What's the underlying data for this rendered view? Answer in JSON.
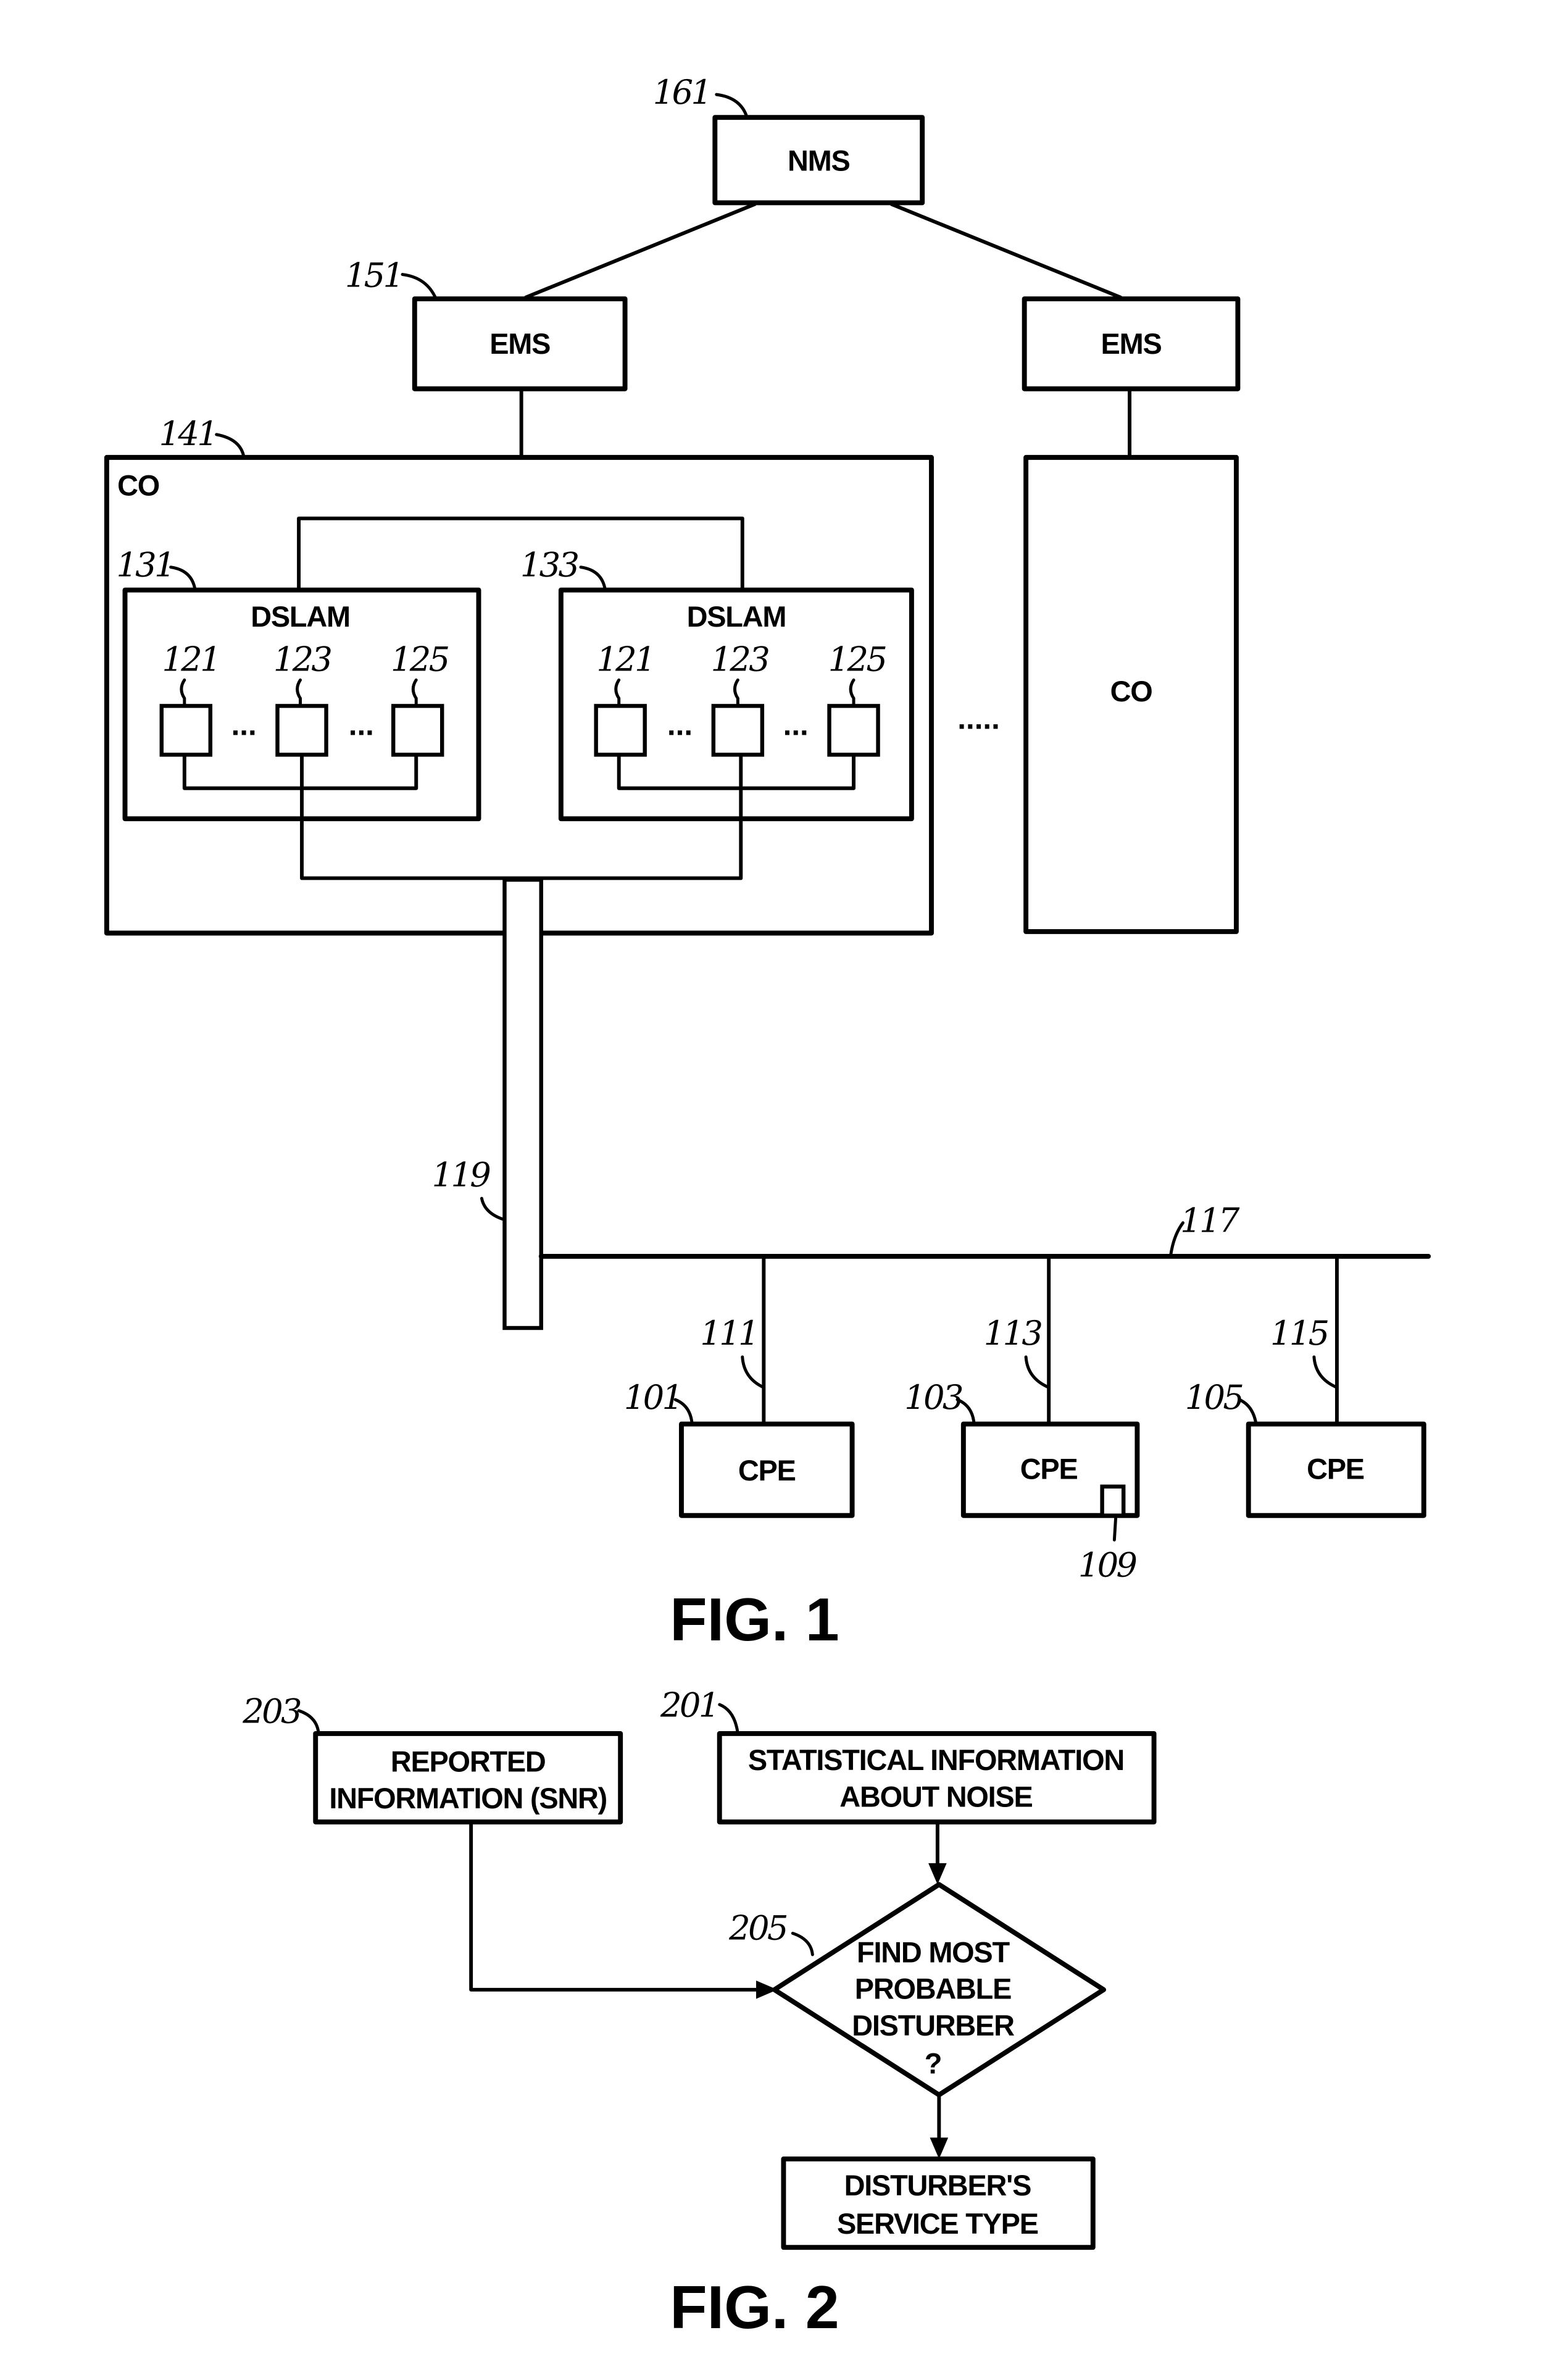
{
  "fig1": {
    "caption": "FIG. 1",
    "nms": {
      "label": "NMS",
      "ref": "161"
    },
    "ems_left": {
      "label": "EMS",
      "ref": "151"
    },
    "ems_right": {
      "label": "EMS"
    },
    "co_main": {
      "label": "CO",
      "ref": "141"
    },
    "co_right": {
      "label": "CO"
    },
    "dslam_left": {
      "label": "DSLAM",
      "ref": "131",
      "ports": [
        {
          "ref": "121"
        },
        {
          "ref": "123"
        },
        {
          "ref": "125"
        }
      ],
      "ellipsis": "..."
    },
    "dslam_right": {
      "label": "DSLAM",
      "ref": "133",
      "ports": [
        {
          "ref": "121"
        },
        {
          "ref": "123"
        },
        {
          "ref": "125"
        }
      ],
      "ellipsis": "..."
    },
    "co_separator": ".....",
    "binder_ref": "119",
    "bus_ref": "117",
    "drops": [
      {
        "line_ref": "111",
        "cpe_ref": "101",
        "label": "CPE"
      },
      {
        "line_ref": "113",
        "cpe_ref": "103",
        "label": "CPE",
        "module_ref": "109"
      },
      {
        "line_ref": "115",
        "cpe_ref": "105",
        "label": "CPE"
      }
    ]
  },
  "fig2": {
    "caption": "FIG. 2",
    "reported": {
      "ref": "203",
      "lines": [
        "REPORTED",
        "INFORMATION (SNR)"
      ]
    },
    "statistical": {
      "ref": "201",
      "lines": [
        "STATISTICAL INFORMATION",
        "ABOUT NOISE"
      ]
    },
    "decision": {
      "ref": "205",
      "lines": [
        "FIND MOST",
        "PROBABLE",
        "DISTURBER",
        "?"
      ]
    },
    "result": {
      "lines": [
        "DISTURBER'S",
        "SERVICE TYPE"
      ]
    }
  }
}
